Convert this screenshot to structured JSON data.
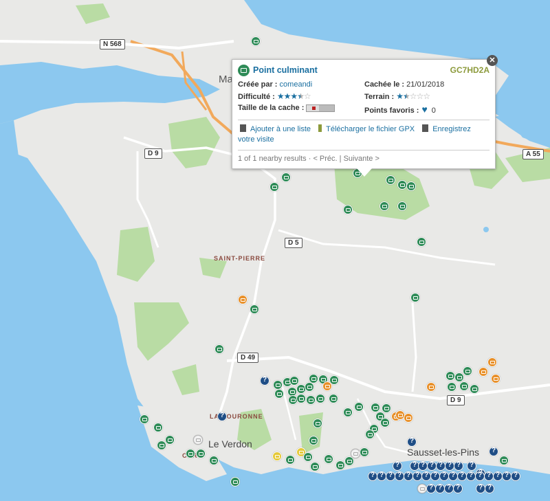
{
  "map": {
    "roads": [
      "N 568",
      "D 9",
      "A 55",
      "D 5",
      "D 49",
      "D 9"
    ],
    "places": [
      "SAINT-PIERRE",
      "LA COURONNE"
    ],
    "towns": [
      "Le Verdon",
      "Sausset-les-Pins"
    ],
    "fragments": [
      "Ma",
      "CAR"
    ],
    "colors": {
      "sea": "#8cc8ef",
      "land": "#e9e9e7",
      "forest": "#b9dca4",
      "road": "#ffffff",
      "highway": "#f2a95b",
      "cache_traditional": "#2e8b57",
      "cache_multi": "#e8902a",
      "cache_mystery": "#1f4e86"
    }
  },
  "popup": {
    "title": "Point culminant",
    "code": "GC7HD2A",
    "created_label": "Créée par :",
    "created_value": "comeandi",
    "hidden_label": "Cachée le :",
    "hidden_value": "21/01/2018",
    "difficulty_label": "Difficulté :",
    "difficulty_value": 3.5,
    "terrain_label": "Terrain :",
    "terrain_value": 1.5,
    "size_label": "Taille de la cache :",
    "favorites_label": "Points favoris :",
    "favorites_value": "0",
    "action_list": "Ajouter à une liste",
    "action_gpx": "Télécharger le fichier GPX",
    "action_log": "Enregistrez votre visite",
    "results_text": "1 of 1 nearby results",
    "prev": "< Préc.",
    "next": "Suivante >",
    "close_icon": "close-icon"
  }
}
